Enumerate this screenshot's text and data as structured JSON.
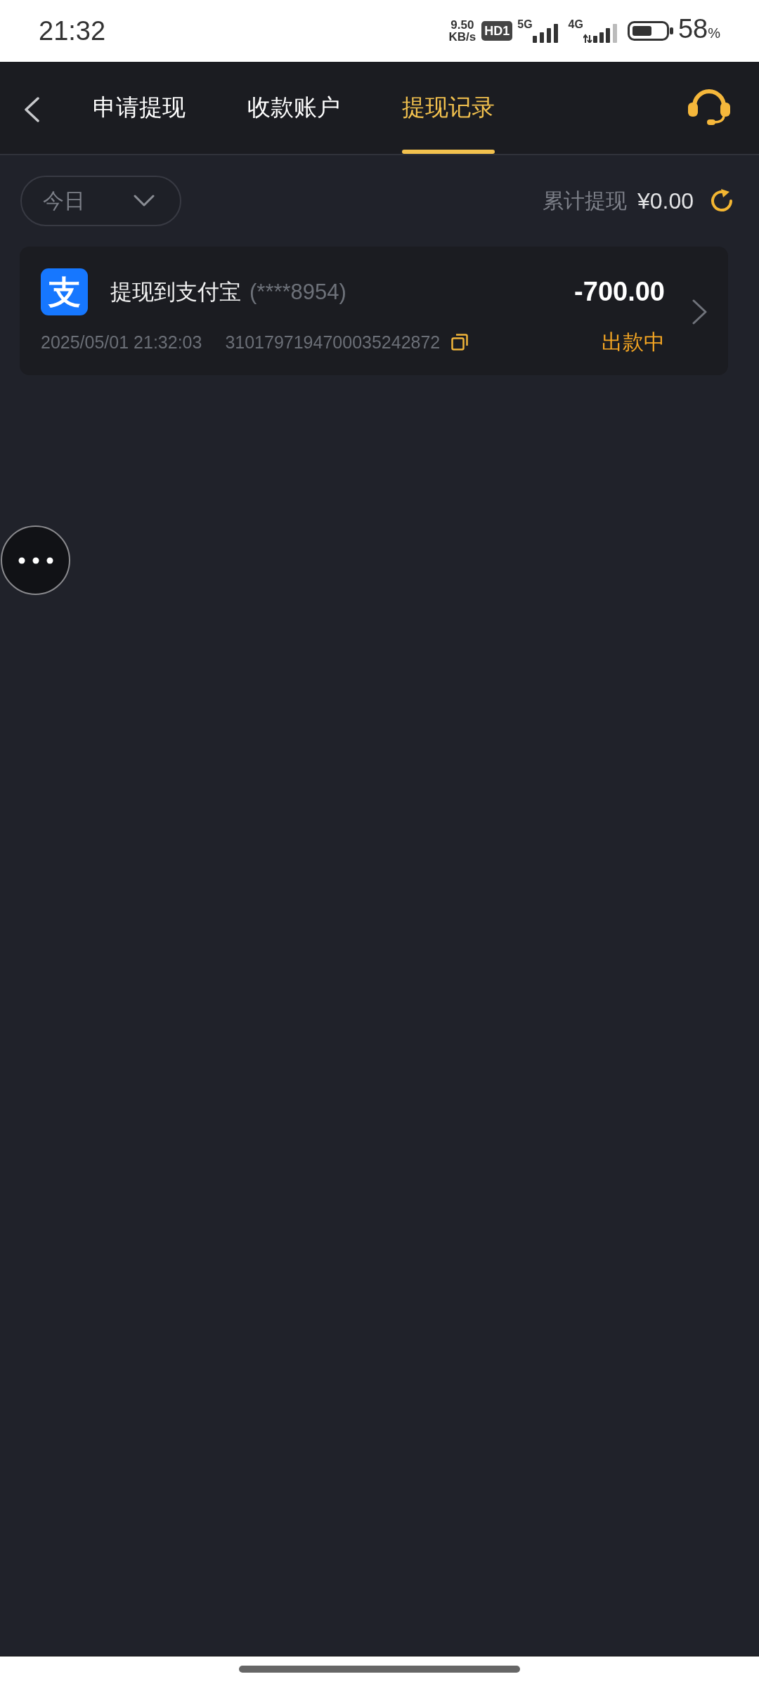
{
  "status_bar": {
    "time": "21:32",
    "network_speed": {
      "value": "9.50",
      "unit": "KB/s"
    },
    "hd_badge": "HD1",
    "signal_1_label": "5G",
    "signal_2_label": "4G",
    "battery_percent": {
      "value": "58",
      "unit": "%"
    }
  },
  "tabs": [
    {
      "label": "申请提现",
      "selected": false
    },
    {
      "label": "收款账户",
      "selected": false
    },
    {
      "label": "提现记录",
      "selected": true
    }
  ],
  "filter": {
    "period": "今日"
  },
  "summary": {
    "label": "累计提现",
    "amount": "¥0.00"
  },
  "records": [
    {
      "logo_text": "支",
      "title": "提现到支付宝",
      "account": "(****8954)",
      "amount": "-700.00",
      "time": "2025/05/01 21:32:03",
      "order_no": "3101797194700035242872",
      "status": "出款中"
    }
  ]
}
